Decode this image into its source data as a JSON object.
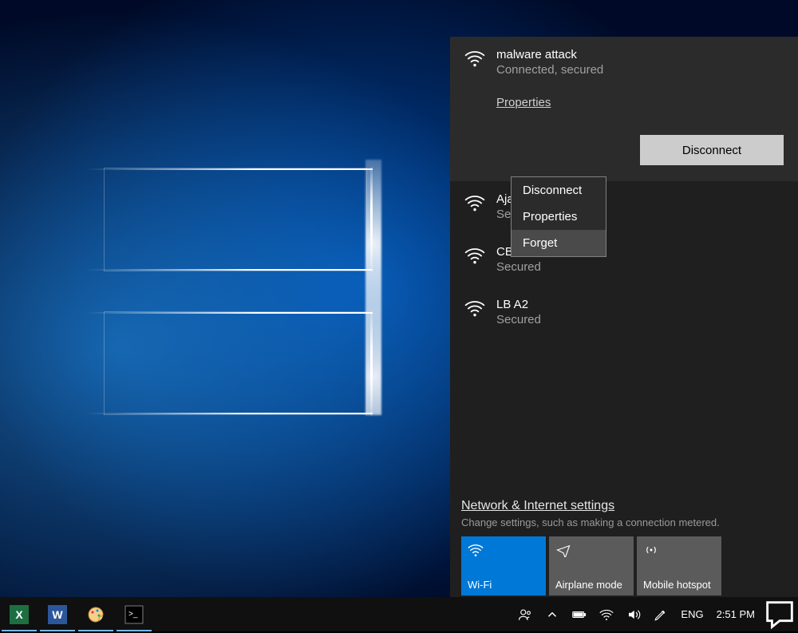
{
  "connected_network": {
    "name": "malware attack",
    "status": "Connected, secured",
    "properties_label": "Properties",
    "disconnect_label": "Disconnect"
  },
  "other_networks": [
    {
      "name": "Aja",
      "status": "Se"
    },
    {
      "name": "CB",
      "status": "Secured"
    },
    {
      "name": "LB A2",
      "status": "Secured"
    }
  ],
  "context_menu": {
    "items": [
      "Disconnect",
      "Properties",
      "Forget"
    ],
    "hover_index": 2
  },
  "settings": {
    "link": "Network & Internet settings",
    "subtitle": "Change settings, such as making a connection metered."
  },
  "tiles": [
    {
      "label": "Wi-Fi",
      "icon": "wifi",
      "active": true
    },
    {
      "label": "Airplane mode",
      "icon": "airplane",
      "active": false
    },
    {
      "label": "Mobile hotspot",
      "icon": "hotspot",
      "active": false
    }
  ],
  "taskbar": {
    "apps": [
      {
        "name": "excel",
        "color": "#1d6f42",
        "glyph": "X"
      },
      {
        "name": "word",
        "color": "#2b579a",
        "glyph": "W"
      },
      {
        "name": "paint",
        "color": "#e08a2c",
        "glyph": ""
      },
      {
        "name": "terminal",
        "color": "#000000",
        "glyph": ">"
      }
    ],
    "language": "ENG",
    "clock": "2:51 PM"
  }
}
